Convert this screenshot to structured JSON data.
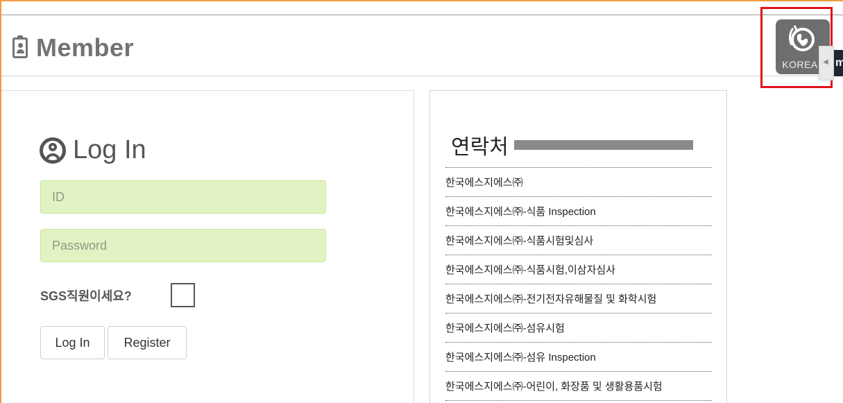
{
  "header": {
    "title": "Member"
  },
  "region_switcher": {
    "label": "KOREA",
    "side_tab_label": "m"
  },
  "login": {
    "title": "Log In",
    "id_placeholder": "ID",
    "password_placeholder": "Password",
    "staff_question": "SGS직원이세요?",
    "login_button": "Log In",
    "register_button": "Register"
  },
  "contacts": {
    "title": "연락처",
    "items": [
      "한국에스지에스㈜",
      "한국에스지에스㈜-식품 Inspection",
      "한국에스지에스㈜-식품시험및심사",
      "한국에스지에스㈜-식품시험,이삼자심사",
      "한국에스지에스㈜-전기전자유해물질 및 화학시험",
      "한국에스지에스㈜-섬유시험",
      "한국에스지에스㈜-섬유 Inspection",
      "한국에스지에스㈜-어린이, 화장품 및 생활용품시험"
    ]
  },
  "colors": {
    "accent_border": "#f29b42",
    "input_bg": "#e1f3c3",
    "highlight_box": "#e0131a"
  }
}
